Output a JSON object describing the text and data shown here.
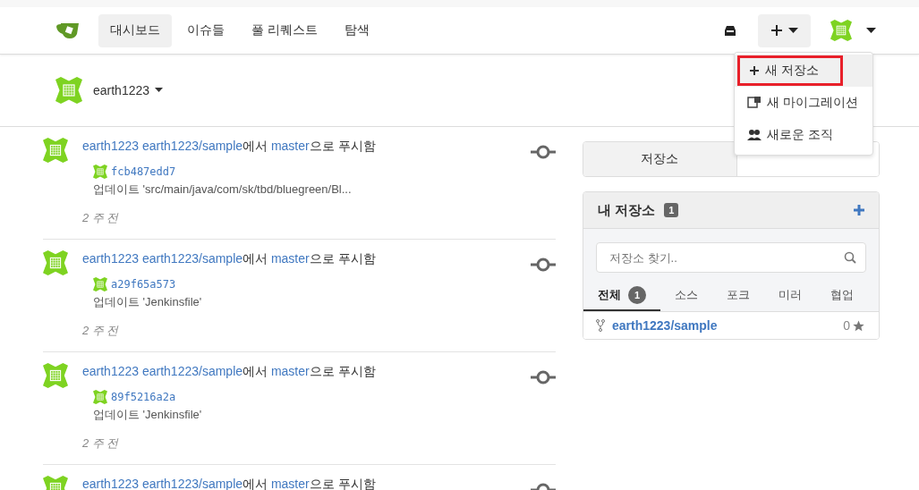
{
  "nav": {
    "items": [
      {
        "label": "대시보드",
        "selected": true
      },
      {
        "label": "이슈들",
        "selected": false
      },
      {
        "label": "풀 리퀘스트",
        "selected": false
      },
      {
        "label": "탐색",
        "selected": false
      }
    ],
    "create_menu": {
      "expanded": true,
      "items": [
        {
          "kind": "repo",
          "label": "새 저장소",
          "highlighted": true
        },
        {
          "kind": "migration",
          "label": "새 마이그레이션",
          "highlighted": false
        },
        {
          "kind": "org",
          "label": "새로운 조직",
          "highlighted": false
        }
      ]
    }
  },
  "context": {
    "user": "earth1223"
  },
  "feed": [
    {
      "actor": "earth1223",
      "repo": "earth1223/sample",
      "text1": "에서",
      "branch": "master",
      "text2": "으로 푸시함",
      "sha": "fcb487edd7",
      "message": "업데이트 'src/main/java/com/sk/tbd/bluegreen/Bl...",
      "time": "2 주 전"
    },
    {
      "actor": "earth1223",
      "repo": "earth1223/sample",
      "text1": "에서",
      "branch": "master",
      "text2": "으로 푸시함",
      "sha": "a29f65a573",
      "message": "업데이트 'Jenkinsfile'",
      "time": "2 주 전"
    },
    {
      "actor": "earth1223",
      "repo": "earth1223/sample",
      "text1": "에서",
      "branch": "master",
      "text2": "으로 푸시함",
      "sha": "89f5216a2a",
      "message": "업데이트 'Jenkinsfile'",
      "time": "2 주 전"
    },
    {
      "actor": "earth1223",
      "repo": "earth1223/sample",
      "text1": "에서",
      "branch": "master",
      "text2": "으로 푸시함"
    }
  ],
  "side_tabs": [
    {
      "label": "저장소",
      "selected": true
    },
    {
      "selected": false
    }
  ],
  "repos_panel": {
    "title": "내 저장소",
    "count": "1",
    "search": {
      "placeholder": "저장소 찾기.."
    },
    "filters": [
      {
        "label": "전체",
        "count": "1",
        "selected": true
      },
      {
        "label": "소스",
        "selected": false
      },
      {
        "label": "포크",
        "selected": false
      },
      {
        "label": "미러",
        "selected": false
      },
      {
        "label": "협업",
        "selected": false
      }
    ],
    "repos": [
      {
        "name": "earth1223/sample",
        "stars": "0"
      }
    ]
  }
}
